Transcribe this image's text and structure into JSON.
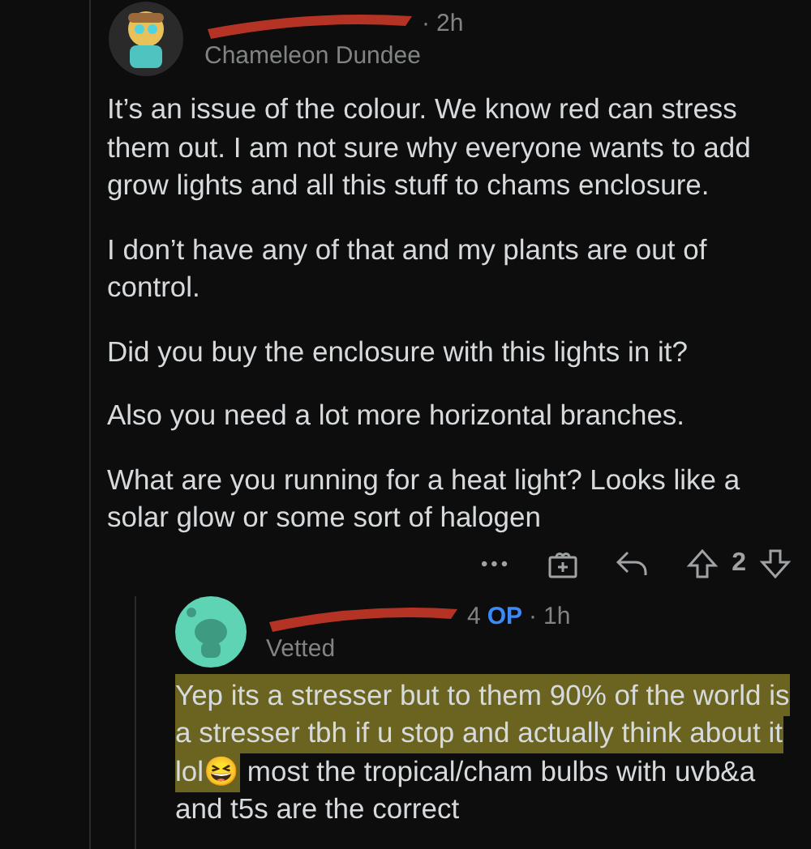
{
  "comments": [
    {
      "separator": "·",
      "time": "2h",
      "flair": "Chameleon Dundee",
      "paragraphs": [
        [
          {
            "text": "It’s an issue of the colour. We know red can stress them out. I am not sure why everyone wants to add grow lights and all this stuff to chams enclosure.",
            "highlighted": false
          }
        ],
        [
          {
            "text": "I don’t have any of that and my plants are out of control.",
            "highlighted": false
          }
        ],
        [
          {
            "text": "Did you buy the enclosure with this lights in it?",
            "highlighted": false
          }
        ],
        [
          {
            "text": "Also you need a lot more horizontal branches.",
            "highlighted": false
          }
        ],
        [
          {
            "text": "What are you running for a heat light? Looks like a solar glow or some sort of halogen",
            "highlighted": false
          }
        ]
      ],
      "actions": {
        "more": "•••",
        "votes": "2"
      }
    },
    {
      "name_fragment": "4",
      "op_label": "OP",
      "separator": "·",
      "time": "1h",
      "flair": "Vetted",
      "paragraphs": [
        [
          {
            "text": "Yep its a stresser but to them 90% of the world is a stresser tbh if u stop and actually think about it lol😆",
            "highlighted": true
          },
          {
            "text": " most the tropical/cham bulbs with uvb&a and t5s are the correct",
            "highlighted": false
          }
        ]
      ]
    }
  ]
}
